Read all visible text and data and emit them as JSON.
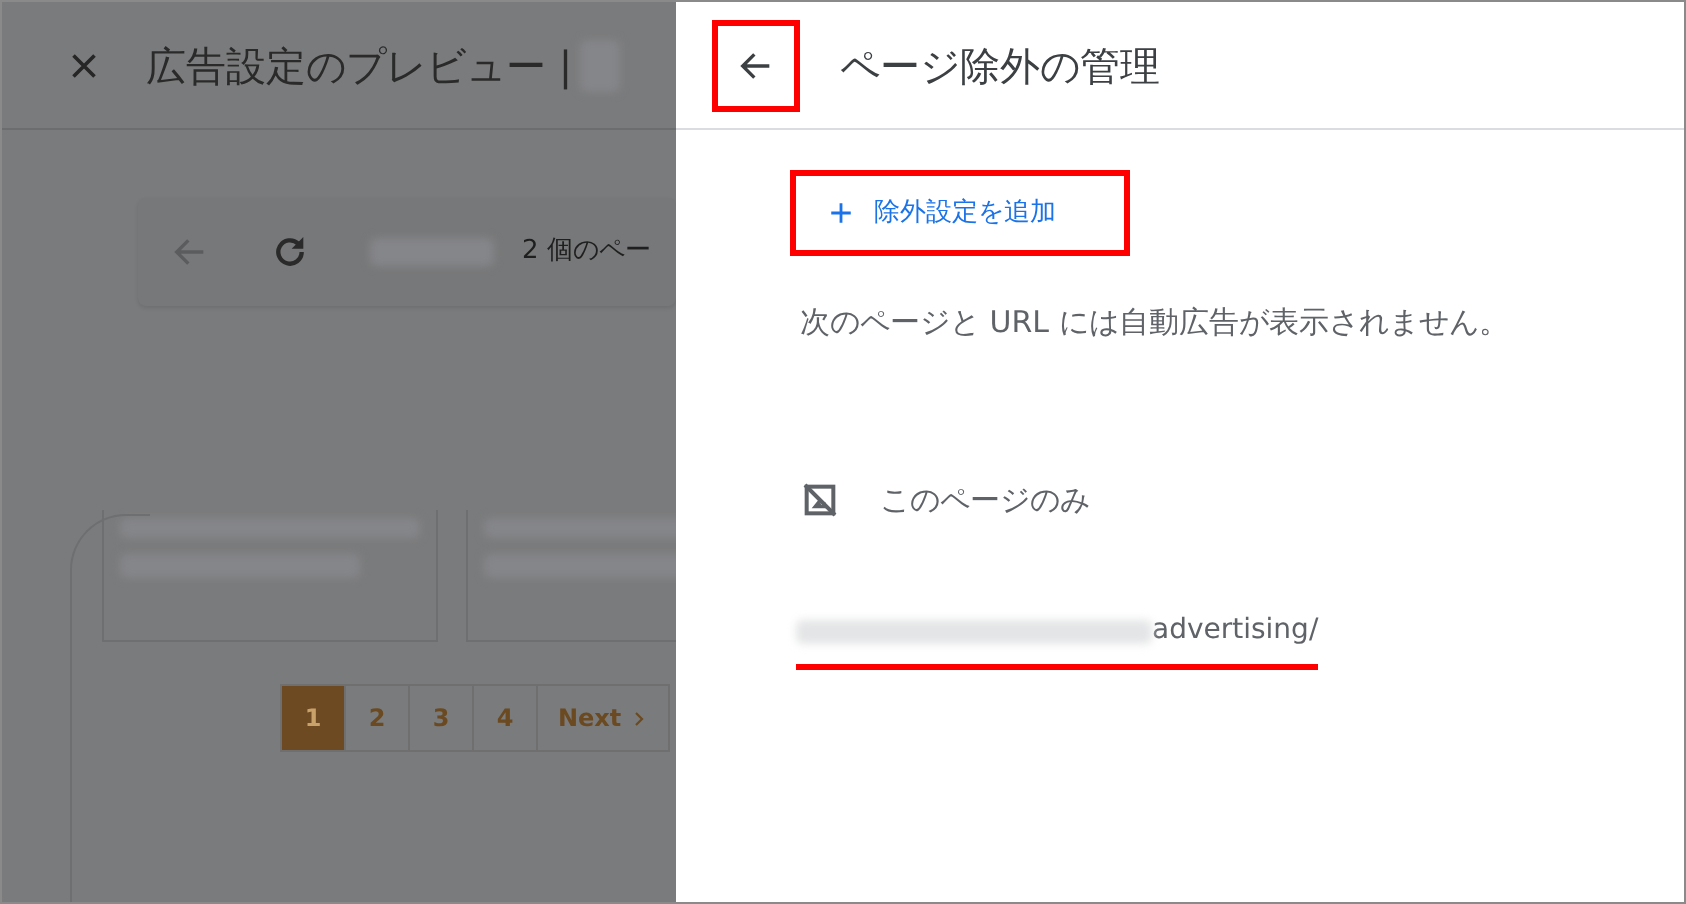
{
  "background_page": {
    "title": "広告設定のプレビュー |",
    "toolbar_text": "2 個のペー",
    "pagination": [
      {
        "label": "1",
        "selected": true
      },
      {
        "label": "2",
        "selected": false
      },
      {
        "label": "3",
        "selected": false
      },
      {
        "label": "4",
        "selected": false
      },
      {
        "label": "Next",
        "selected": false,
        "kind": "next"
      }
    ]
  },
  "panel": {
    "title": "ページ除外の管理",
    "back_highlighted": true,
    "add_button": {
      "label": "除外設定を追加",
      "highlighted": true
    },
    "description": "次のページと URL には自動広告が表示されません。",
    "exclusions": [
      {
        "label": "このページのみ",
        "url": "advertising/",
        "underlined": true
      }
    ]
  }
}
